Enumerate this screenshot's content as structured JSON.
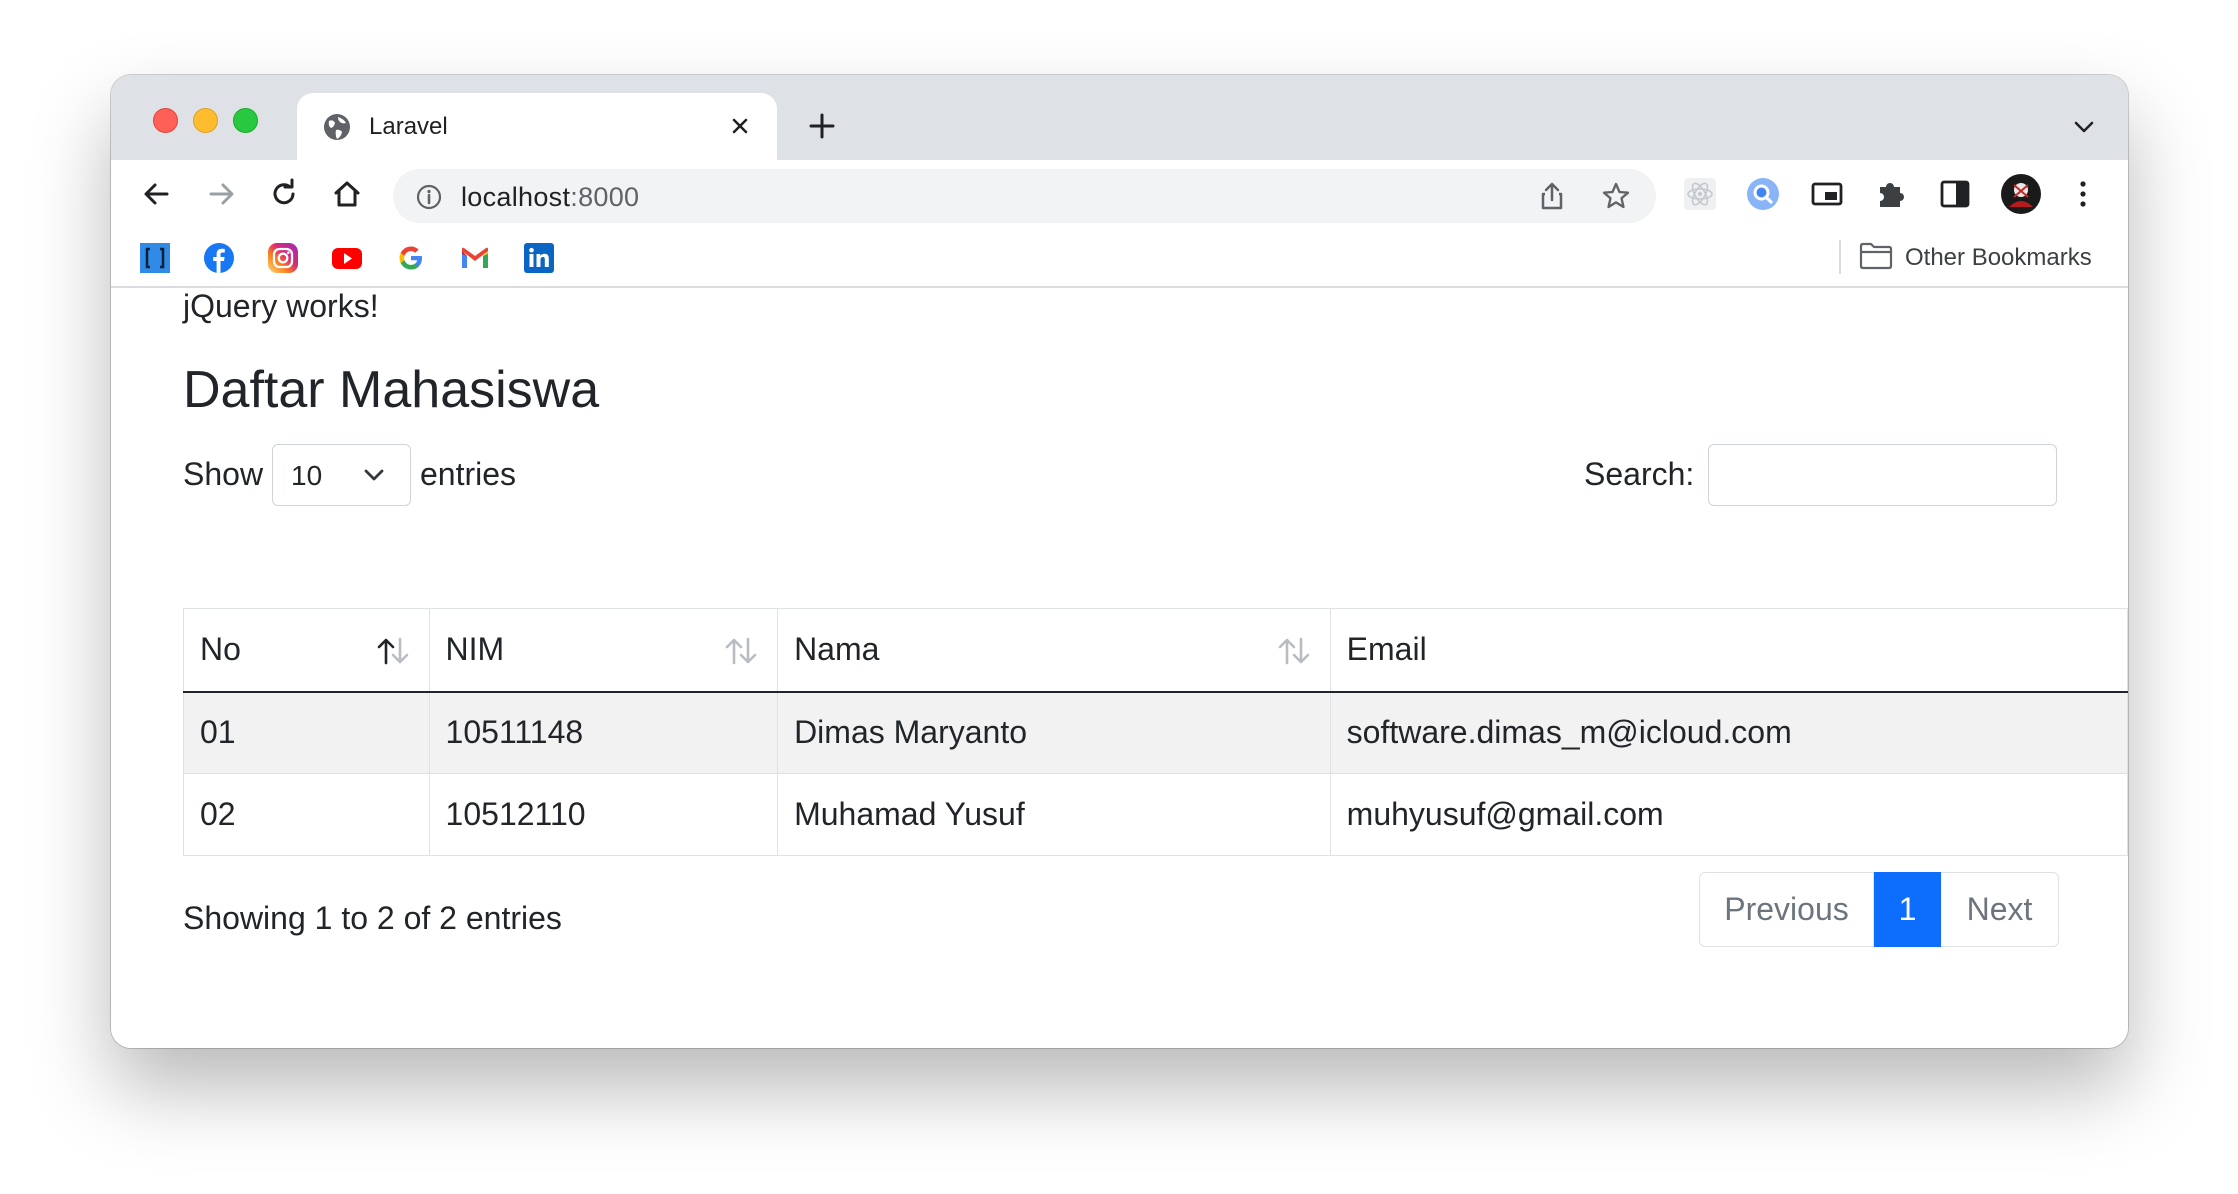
{
  "browser": {
    "tab_title": "Laravel",
    "url_host": "localhost",
    "url_port": ":8000",
    "other_bookmarks": "Other Bookmarks",
    "bookmarks": [
      "brackets-icon",
      "facebook-icon",
      "instagram-icon",
      "youtube-icon",
      "google-icon",
      "gmail-icon",
      "linkedin-icon"
    ]
  },
  "page": {
    "status_text": "jQuery works!",
    "title": "Daftar Mahasiswa"
  },
  "datatable": {
    "length_label_before": "Show",
    "length_value": "10",
    "length_label_after": "entries",
    "search_label": "Search:",
    "search_value": "",
    "columns": [
      "No",
      "NIM",
      "Nama",
      "Email"
    ],
    "rows": [
      [
        "01",
        "10511148",
        "Dimas Maryanto",
        "software.dimas_m@icloud.com"
      ],
      [
        "02",
        "10512110",
        "Muhamad Yusuf",
        "muhyusuf@gmail.com"
      ]
    ],
    "info": "Showing 1 to 2 of 2 entries",
    "pagination": {
      "previous": "Previous",
      "current": "1",
      "next": "Next"
    }
  },
  "colors": {
    "accent": "#0d6efd",
    "stripe": "#f2f2f2",
    "text": "#212529"
  }
}
